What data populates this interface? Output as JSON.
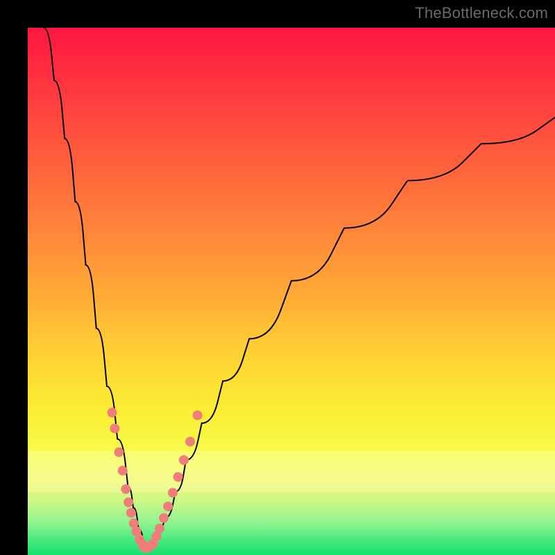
{
  "watermark": {
    "text": "TheBottleneck.com"
  },
  "colors": {
    "frame_bg": "#000000",
    "curve": "#000000",
    "points": "#ef7e7b",
    "gradient_top": "#ff163f",
    "gradient_mid": "#ffd233",
    "gradient_bottom": "#17e06e"
  },
  "chart_data": {
    "type": "line",
    "title": "",
    "xlabel": "",
    "ylabel": "",
    "xlim": [
      0,
      100
    ],
    "ylim": [
      0,
      100
    ],
    "grid": false,
    "legend": false,
    "curve_description": "V-shaped bottleneck curve: steep descent from top-left to a minimum near x≈22, then slower rise toward the right edge reaching about y≈83 at x=100.",
    "series": [
      {
        "name": "bottleneck-curve",
        "x": [
          3,
          5,
          7,
          9,
          11,
          13,
          15,
          17,
          19,
          20,
          21,
          22,
          23,
          24,
          25,
          26,
          28,
          30,
          33,
          37,
          42,
          50,
          60,
          72,
          86,
          100
        ],
        "y": [
          100,
          90,
          79,
          67,
          55,
          43,
          32,
          22,
          13,
          9,
          5,
          2,
          2,
          3,
          5,
          7,
          12,
          18,
          25,
          33,
          41,
          52,
          62,
          71,
          78,
          83
        ]
      },
      {
        "name": "left-arm-points",
        "x": [
          16.0,
          16.5,
          17.3,
          18.0,
          18.6,
          19.1,
          19.6,
          20.1,
          20.6,
          21.2,
          21.8
        ],
        "y": [
          27.0,
          24.0,
          19.5,
          16.0,
          12.5,
          10.0,
          8.0,
          6.0,
          4.5,
          3.0,
          2.0
        ]
      },
      {
        "name": "valley-points",
        "x": [
          22.0,
          22.6,
          23.2,
          23.8
        ],
        "y": [
          1.5,
          1.3,
          1.6,
          2.2
        ]
      },
      {
        "name": "right-arm-points",
        "x": [
          24.4,
          25.0,
          25.8,
          26.6,
          27.5,
          28.5,
          29.6,
          30.8,
          32.2
        ],
        "y": [
          3.5,
          5.0,
          7.0,
          9.2,
          11.8,
          14.8,
          18.0,
          21.5,
          26.5
        ]
      }
    ]
  }
}
